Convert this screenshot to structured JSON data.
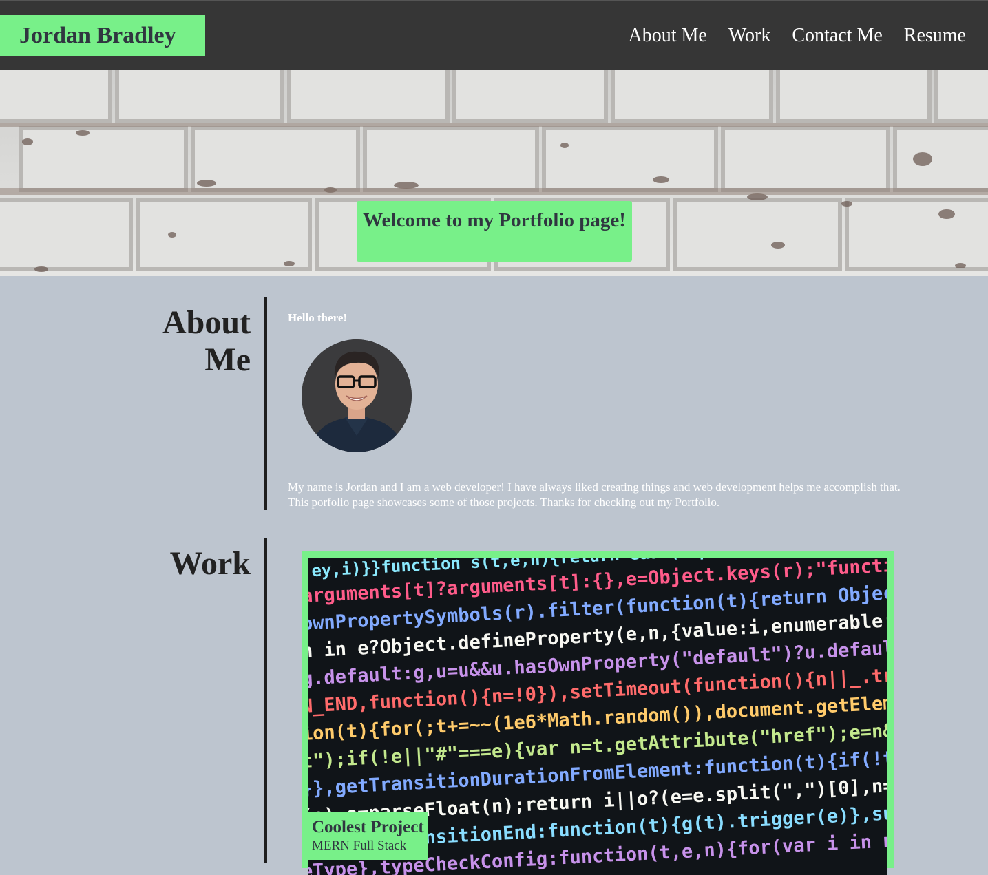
{
  "header": {
    "brand": "Jordan Bradley",
    "nav": [
      "About Me",
      "Work",
      "Contact Me",
      "Resume"
    ]
  },
  "hero": {
    "welcome": "Welcome to my Portfolio page!"
  },
  "about": {
    "heading": "About Me",
    "greeting": "Hello there!",
    "bio": "My name is Jordan and I am a web developer! I have always liked creating things and web development helps me accomplish that. This porfolio page showcases some of those projects. Thanks for checking out my Portfolio."
  },
  "work": {
    "heading": "Work",
    "projects": [
      {
        "title": "Coolest Project",
        "subtitle": "MERN Full Stack"
      }
    ]
  },
  "colors": {
    "accent": "#78f089",
    "header_bg": "#363636",
    "page_bg": "#bdc5cf"
  }
}
